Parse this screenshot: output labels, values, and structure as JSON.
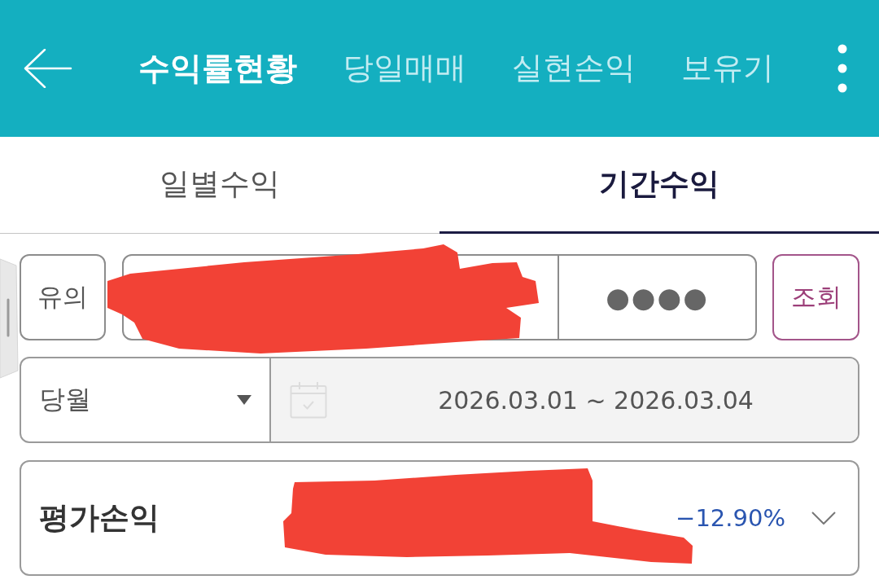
{
  "app_bar": {
    "tabs": [
      {
        "label": "수익률현황",
        "selected": true
      },
      {
        "label": "당일매매",
        "selected": false
      },
      {
        "label": "실현손익",
        "selected": false
      },
      {
        "label": "보유기",
        "selected": false
      }
    ]
  },
  "sub_tabs": [
    {
      "label": "일별수익",
      "selected": false
    },
    {
      "label": "기간수익",
      "selected": true
    }
  ],
  "account_row": {
    "notice_button": "유의",
    "password": "●●●●",
    "search_button": "조회"
  },
  "period_row": {
    "period_select": "당월",
    "date_range": "2026.03.01 ~ 2026.03.04"
  },
  "summary": {
    "label": "평가손익",
    "rate": "−12.90%",
    "expanded": false
  }
}
